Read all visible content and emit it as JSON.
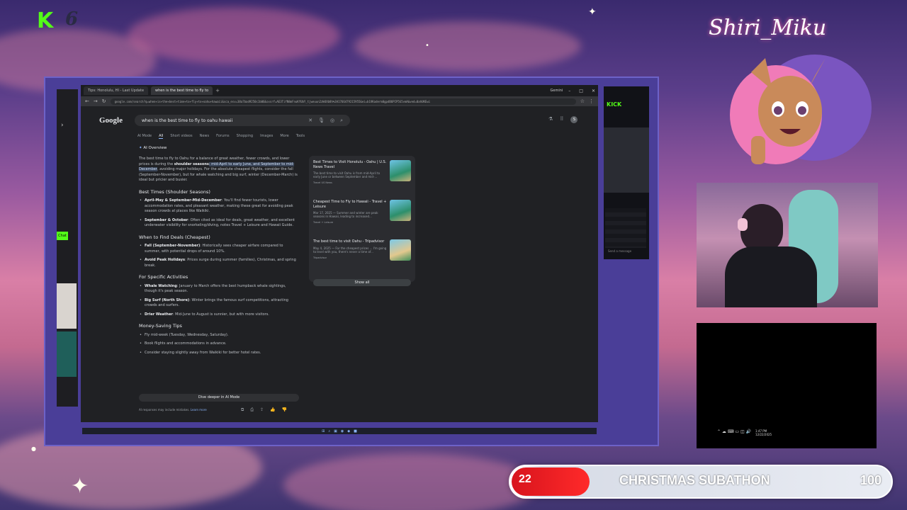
{
  "overlay": {
    "brand_letter": "K",
    "brand_number": "6",
    "streamer_name": "Shiri_Miku",
    "subathon": {
      "current": "22",
      "label": "CHRISTMAS SUBATHON",
      "goal": "100",
      "progress_fraction": 0.22
    },
    "colors": {
      "kick_green": "#53fc18",
      "subathon_red": "#e11b22"
    }
  },
  "browser": {
    "tabs": [
      {
        "label": "Tips: Honolulu, HI - Last Update"
      },
      {
        "label": "when is the best time to fly to"
      }
    ],
    "gemini_label": "Gemini",
    "url": "google.com/search?q=when+is+the+best+time+to+fly+to+oahu+hawaii&sca_esv=38a7bad9250c1b06&sxsrf=AE3TifN8mFnuKYUbY_tjweuun2zW4Xb8h%3A1766479215955&ei=b1VKaderm0gpdB6PIP5G5vmA&ved=0ahUKEwi",
    "logo": "Google",
    "search_query": "when is the best time to fly to oahu hawaii",
    "search_tabs": [
      "AI Mode",
      "All",
      "Short videos",
      "News",
      "Forums",
      "Shopping",
      "Images",
      "More",
      "Tools"
    ],
    "active_tab": "All",
    "ai_overview_label": "AI Overview",
    "intro_before": "The best time to fly to Oahu for a balance of great weather, fewer crowds, and lower prices is during the ",
    "intro_bold": "shoulder seasons",
    "intro_highlight": ": mid-April to early June, and September to mid-December",
    "intro_after": ", avoiding major holidays. For the absolute cheapest flights, consider the fall (September-November), but for whale watching and big surf, winter (December-March) is ideal but pricier and busier.",
    "sections": [
      {
        "heading": "Best Times (Shoulder Seasons)",
        "items": [
          {
            "bold": "April-May & September-Mid-December",
            "text": ": You'll find fewer tourists, lower accommodation rates, and pleasant weather, making these great for avoiding peak season crowds at places like Waikiki."
          },
          {
            "bold": "September & October",
            "text": ": Often cited as ideal for deals, great weather, and excellent underwater visibility for snorkeling/diving, notes Travel + Leisure and Hawaii Guide."
          }
        ]
      },
      {
        "heading": "When to Find Deals (Cheapest)",
        "items": [
          {
            "bold": "Fall (September-November)",
            "text": ": Historically sees cheaper airfare compared to summer, with potential drops of around 10%."
          },
          {
            "bold": "Avoid Peak Holidays",
            "text": ": Prices surge during summer (families), Christmas, and spring break."
          }
        ]
      },
      {
        "heading": "For Specific Activities",
        "items": [
          {
            "bold": "Whale Watching",
            "text": ": January to March offers the best humpback whale sightings, though it's peak season."
          },
          {
            "bold": "Big Surf (North Shore)",
            "text": ": Winter brings the famous surf competitions, attracting crowds and surfers."
          },
          {
            "bold": "Drier Weather",
            "text": ": Mid-June to August is sunnier, but with more visitors."
          }
        ]
      },
      {
        "heading": "Money-Saving Tips",
        "items": [
          {
            "bold": "",
            "text": "Fly mid-week (Tuesday, Wednesday, Saturday)."
          },
          {
            "bold": "",
            "text": "Book flights and accommodations in advance."
          },
          {
            "bold": "",
            "text": "Consider staying slightly away from Waikiki for better hotel rates."
          }
        ]
      }
    ],
    "dive_deeper": "Dive deeper in AI Mode",
    "disclaimer": "AI responses may include mistakes.",
    "learn_more": "Learn more",
    "sources": [
      {
        "title": "Best Times to Visit Honolulu - Oahu | U.S. News Travel",
        "snippet": "The best time to visit Oahu is from mid-April to early June or between September and mid-...",
        "publisher": "Travel US News"
      },
      {
        "title": "Cheapest Time to Fly to Hawaii - Travel + Leisure",
        "snippet": "Mar 17, 2025 — Summer and winter are peak seasons in Hawaii, leading to increased...",
        "publisher": "Travel + Leisure"
      },
      {
        "title": "The best time to visit Oahu - Tripadvisor",
        "snippet": "May 4, 2025 — For the cheapest prices ... I'm going to level with you, there's never a time of...",
        "publisher": "Tripadvisor"
      }
    ],
    "show_all": "Show all",
    "avatar_letter": "S"
  },
  "side": {
    "chat_label": "Chat",
    "kick_label": "KICK",
    "send_placeholder": "Send a message",
    "clock_time": "1:47 PM",
    "clock_date": "12/22/2025"
  }
}
